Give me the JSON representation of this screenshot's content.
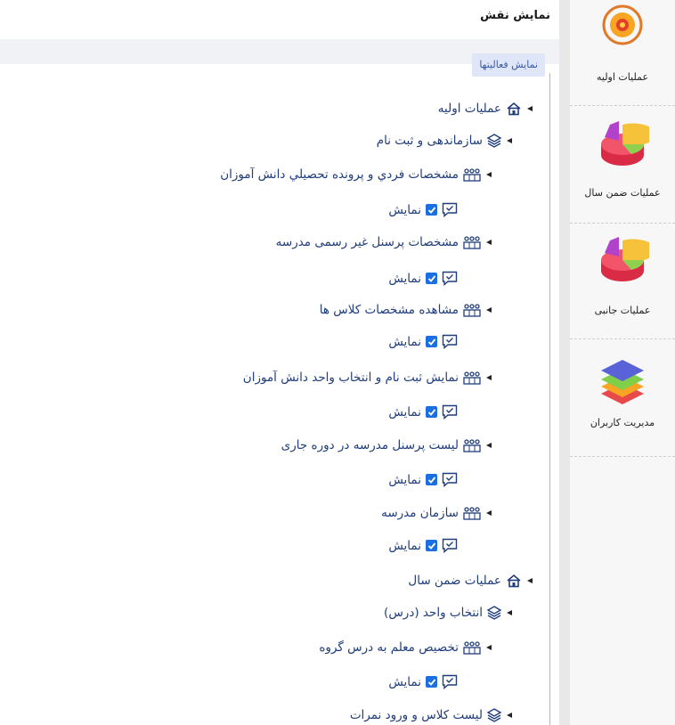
{
  "header": {
    "title": "نمایش نقش"
  },
  "activities_tab": {
    "label": "نمایش فعالیتها"
  },
  "tree": {
    "root1": "عملیات اولیه",
    "group1": "سازماندهی و ثبت نام",
    "item1": "مشخصات فردي و پرونده تحصيلي دانش آموزان",
    "item2": "مشخصات پرسنل غیر رسمی مدرسه",
    "item3": "مشاهده مشخصات کلاس ها",
    "item4": "نمایش ثبت نام و انتخاب واحد دانش آموزان",
    "item5": "لیست پرسنل مدرسه در دوره جاری",
    "item6": "سازمان مدرسه",
    "root2": "عملیات ضمن سال",
    "group2": "انتخاب واحد (درس)",
    "item7": "تخصیص معلم به درس گروه",
    "group3": "لیست کلاس و ورود نمرات",
    "permission_label": "نمایش"
  },
  "sidebar": {
    "items": [
      {
        "label": "عملیات اولیه",
        "icon": "gear-icon"
      },
      {
        "label": "عملیات ضمن سال",
        "icon": "pie-chart-icon"
      },
      {
        "label": "عملیات جانبی",
        "icon": "pie-chart-icon"
      },
      {
        "label": "مدیریت کاربران",
        "icon": "layers-icon"
      }
    ]
  },
  "colors": {
    "tree_text": "#1f3d7a",
    "checkbox": "#1b6fe0",
    "tab_bg": "#dfe6f7"
  }
}
